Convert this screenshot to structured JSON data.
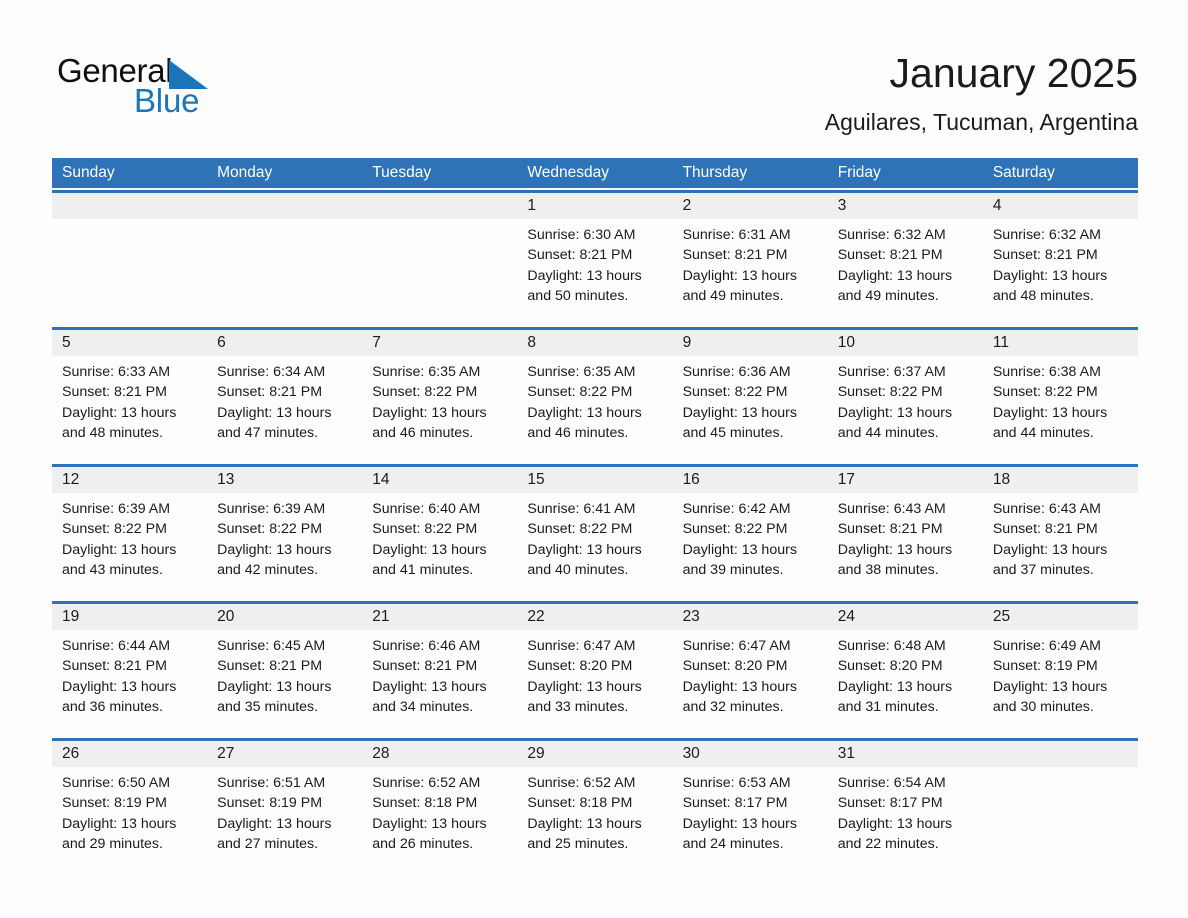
{
  "brand": {
    "name_part1": "General",
    "name_part2": "Blue",
    "triangle_color": "#1b75bb",
    "logo_icon": "blue-triangle-icon"
  },
  "header": {
    "title": "January 2025",
    "subtitle": "Aguilares, Tucuman, Argentina"
  },
  "theme": {
    "header_blue": "#2e72b8",
    "row_rule_blue": "#2e72b8",
    "number_band_gray": "#efefef",
    "page_background": "#fdfdfd",
    "text_color": "#1b1b1b"
  },
  "weekdays": [
    "Sunday",
    "Monday",
    "Tuesday",
    "Wednesday",
    "Thursday",
    "Friday",
    "Saturday"
  ],
  "weeks": [
    [
      {
        "day": "",
        "lines": []
      },
      {
        "day": "",
        "lines": []
      },
      {
        "day": "",
        "lines": []
      },
      {
        "day": "1",
        "lines": [
          "Sunrise: 6:30 AM",
          "Sunset: 8:21 PM",
          "Daylight: 13 hours",
          "and 50 minutes."
        ]
      },
      {
        "day": "2",
        "lines": [
          "Sunrise: 6:31 AM",
          "Sunset: 8:21 PM",
          "Daylight: 13 hours",
          "and 49 minutes."
        ]
      },
      {
        "day": "3",
        "lines": [
          "Sunrise: 6:32 AM",
          "Sunset: 8:21 PM",
          "Daylight: 13 hours",
          "and 49 minutes."
        ]
      },
      {
        "day": "4",
        "lines": [
          "Sunrise: 6:32 AM",
          "Sunset: 8:21 PM",
          "Daylight: 13 hours",
          "and 48 minutes."
        ]
      }
    ],
    [
      {
        "day": "5",
        "lines": [
          "Sunrise: 6:33 AM",
          "Sunset: 8:21 PM",
          "Daylight: 13 hours",
          "and 48 minutes."
        ]
      },
      {
        "day": "6",
        "lines": [
          "Sunrise: 6:34 AM",
          "Sunset: 8:21 PM",
          "Daylight: 13 hours",
          "and 47 minutes."
        ]
      },
      {
        "day": "7",
        "lines": [
          "Sunrise: 6:35 AM",
          "Sunset: 8:22 PM",
          "Daylight: 13 hours",
          "and 46 minutes."
        ]
      },
      {
        "day": "8",
        "lines": [
          "Sunrise: 6:35 AM",
          "Sunset: 8:22 PM",
          "Daylight: 13 hours",
          "and 46 minutes."
        ]
      },
      {
        "day": "9",
        "lines": [
          "Sunrise: 6:36 AM",
          "Sunset: 8:22 PM",
          "Daylight: 13 hours",
          "and 45 minutes."
        ]
      },
      {
        "day": "10",
        "lines": [
          "Sunrise: 6:37 AM",
          "Sunset: 8:22 PM",
          "Daylight: 13 hours",
          "and 44 minutes."
        ]
      },
      {
        "day": "11",
        "lines": [
          "Sunrise: 6:38 AM",
          "Sunset: 8:22 PM",
          "Daylight: 13 hours",
          "and 44 minutes."
        ]
      }
    ],
    [
      {
        "day": "12",
        "lines": [
          "Sunrise: 6:39 AM",
          "Sunset: 8:22 PM",
          "Daylight: 13 hours",
          "and 43 minutes."
        ]
      },
      {
        "day": "13",
        "lines": [
          "Sunrise: 6:39 AM",
          "Sunset: 8:22 PM",
          "Daylight: 13 hours",
          "and 42 minutes."
        ]
      },
      {
        "day": "14",
        "lines": [
          "Sunrise: 6:40 AM",
          "Sunset: 8:22 PM",
          "Daylight: 13 hours",
          "and 41 minutes."
        ]
      },
      {
        "day": "15",
        "lines": [
          "Sunrise: 6:41 AM",
          "Sunset: 8:22 PM",
          "Daylight: 13 hours",
          "and 40 minutes."
        ]
      },
      {
        "day": "16",
        "lines": [
          "Sunrise: 6:42 AM",
          "Sunset: 8:22 PM",
          "Daylight: 13 hours",
          "and 39 minutes."
        ]
      },
      {
        "day": "17",
        "lines": [
          "Sunrise: 6:43 AM",
          "Sunset: 8:21 PM",
          "Daylight: 13 hours",
          "and 38 minutes."
        ]
      },
      {
        "day": "18",
        "lines": [
          "Sunrise: 6:43 AM",
          "Sunset: 8:21 PM",
          "Daylight: 13 hours",
          "and 37 minutes."
        ]
      }
    ],
    [
      {
        "day": "19",
        "lines": [
          "Sunrise: 6:44 AM",
          "Sunset: 8:21 PM",
          "Daylight: 13 hours",
          "and 36 minutes."
        ]
      },
      {
        "day": "20",
        "lines": [
          "Sunrise: 6:45 AM",
          "Sunset: 8:21 PM",
          "Daylight: 13 hours",
          "and 35 minutes."
        ]
      },
      {
        "day": "21",
        "lines": [
          "Sunrise: 6:46 AM",
          "Sunset: 8:21 PM",
          "Daylight: 13 hours",
          "and 34 minutes."
        ]
      },
      {
        "day": "22",
        "lines": [
          "Sunrise: 6:47 AM",
          "Sunset: 8:20 PM",
          "Daylight: 13 hours",
          "and 33 minutes."
        ]
      },
      {
        "day": "23",
        "lines": [
          "Sunrise: 6:47 AM",
          "Sunset: 8:20 PM",
          "Daylight: 13 hours",
          "and 32 minutes."
        ]
      },
      {
        "day": "24",
        "lines": [
          "Sunrise: 6:48 AM",
          "Sunset: 8:20 PM",
          "Daylight: 13 hours",
          "and 31 minutes."
        ]
      },
      {
        "day": "25",
        "lines": [
          "Sunrise: 6:49 AM",
          "Sunset: 8:19 PM",
          "Daylight: 13 hours",
          "and 30 minutes."
        ]
      }
    ],
    [
      {
        "day": "26",
        "lines": [
          "Sunrise: 6:50 AM",
          "Sunset: 8:19 PM",
          "Daylight: 13 hours",
          "and 29 minutes."
        ]
      },
      {
        "day": "27",
        "lines": [
          "Sunrise: 6:51 AM",
          "Sunset: 8:19 PM",
          "Daylight: 13 hours",
          "and 27 minutes."
        ]
      },
      {
        "day": "28",
        "lines": [
          "Sunrise: 6:52 AM",
          "Sunset: 8:18 PM",
          "Daylight: 13 hours",
          "and 26 minutes."
        ]
      },
      {
        "day": "29",
        "lines": [
          "Sunrise: 6:52 AM",
          "Sunset: 8:18 PM",
          "Daylight: 13 hours",
          "and 25 minutes."
        ]
      },
      {
        "day": "30",
        "lines": [
          "Sunrise: 6:53 AM",
          "Sunset: 8:17 PM",
          "Daylight: 13 hours",
          "and 24 minutes."
        ]
      },
      {
        "day": "31",
        "lines": [
          "Sunrise: 6:54 AM",
          "Sunset: 8:17 PM",
          "Daylight: 13 hours",
          "and 22 minutes."
        ]
      },
      {
        "day": "",
        "lines": []
      }
    ]
  ]
}
